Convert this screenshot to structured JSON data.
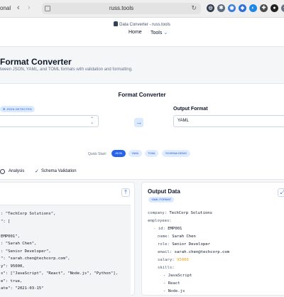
{
  "browser": {
    "tab_label": "onal",
    "url": "russ.tools",
    "colors": {
      "chrome_bg": "#efefef"
    },
    "extensions": [
      {
        "icon": "shield-icon",
        "glyph": "◎",
        "color": "#2f3b4d"
      },
      {
        "icon": "puzzle-icon",
        "glyph": "✱",
        "color": "#5b6b7f"
      },
      {
        "icon": "vpn-icon",
        "glyph": "◉",
        "color": "#3b7dd8"
      },
      {
        "icon": "bitwarden-icon",
        "glyph": "◈",
        "color": "#2f6fd9"
      },
      {
        "icon": "dark-mode-icon",
        "glyph": "◐",
        "color": "#1e88e5"
      },
      {
        "icon": "extensions-icon",
        "glyph": "✚",
        "color": "#4a4a4a"
      },
      {
        "icon": "github-icon",
        "glyph": "●",
        "color": "#222222"
      },
      {
        "icon": "sparkle-icon",
        "glyph": "✦",
        "color": "#6b7280"
      }
    ]
  },
  "header": {
    "breadcrumb": "Data Converter - russ.tools",
    "nav": {
      "home": "Home",
      "tools": "Tools"
    }
  },
  "hero": {
    "title": "Format Converter",
    "subtitle": "tween JSON, YAML, and TOML formats with validation and formatting."
  },
  "converter": {
    "title": "Format Converter",
    "detected_badge": "JSON DETECTED",
    "input_value": "",
    "output_label": "Output Format",
    "output_value": "YAML",
    "quick_start_label": "Quick Start:",
    "quick_start": [
      "JSON",
      "YAML",
      "TOML",
      "SCHEMA DEMO"
    ],
    "accent_color": "#2563eb"
  },
  "tabs": {
    "analysis": "Analysis",
    "schema": "Schema Validation"
  },
  "input_panel": {
    "code_lines": [
      ": \"TechCorp Solutions\",",
      "\": [",
      "",
      "EMP001\",",
      ": \"Sarah Chen\",",
      ": \"Senior Developer\",",
      "\": \"sarah.chen@techcorp.com\",",
      "y\": 95000,",
      "s\": [\"JavaScript\", \"React\", \"Node.js\", \"Python\"],",
      "e\": true,",
      "ate\": \"2021-03-15\""
    ]
  },
  "output_panel": {
    "title": "Output Data",
    "badge": "YAML FORMAT",
    "yaml": {
      "company_key": "company:",
      "company_val": "TechCorp Solutions",
      "employees_key": "employees:",
      "id_key": "- id:",
      "id_val": "EMP001",
      "name_key": "name:",
      "name_val": "Sarah Chen",
      "role_key": "role:",
      "role_val": "Senior Developer",
      "email_key": "email:",
      "email_val": "sarah.chen@techcorp.com",
      "salary_key": "salary:",
      "salary_val": "95000",
      "skills_key": "skills:",
      "skill_1": "- JavaScript",
      "skill_2": "- React",
      "skill_3": "- Node.js"
    }
  }
}
